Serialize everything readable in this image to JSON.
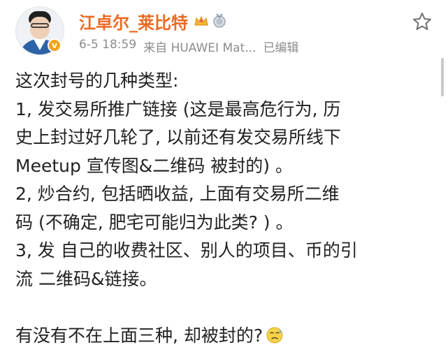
{
  "post": {
    "author": {
      "name": "江卓尔_莱比特",
      "verified_mark": "v",
      "avatar_icon": "avatar-photo",
      "badges": [
        "crown-badge-icon",
        "medal-badge-icon"
      ]
    },
    "meta": {
      "time": "6-5 18:59",
      "source": "来自 HUAWEI Mat...",
      "edited": "已编辑"
    },
    "favorite_icon": "star-outline-icon",
    "body": {
      "line1": "这次封号的几种类型:",
      "line2": "1, 发交易所推广链接 (这是最高危行为, 历",
      "line3": "史上封过好几轮了, 以前还有发交易所线下",
      "line4": "Meetup 宣传图&二维码 被封的) 。",
      "line5": "2, 炒合约, 包括晒收益, 上面有交易所二维",
      "line6": "码 (不确定, 肥宅可能归为此类? ) 。",
      "line7": "3, 发 自己的收费社区、别人的项目、币的引",
      "line8": "流 二维码&链接。",
      "line9": "有没有不在上面三种, 却被封的?",
      "emoji_icon": "sweat-emoji-icon"
    }
  },
  "colors": {
    "username": "#ec6a22",
    "meta_text": "#8c8c8c",
    "body_text": "#222222",
    "verified_badge": "#f6a21c"
  }
}
